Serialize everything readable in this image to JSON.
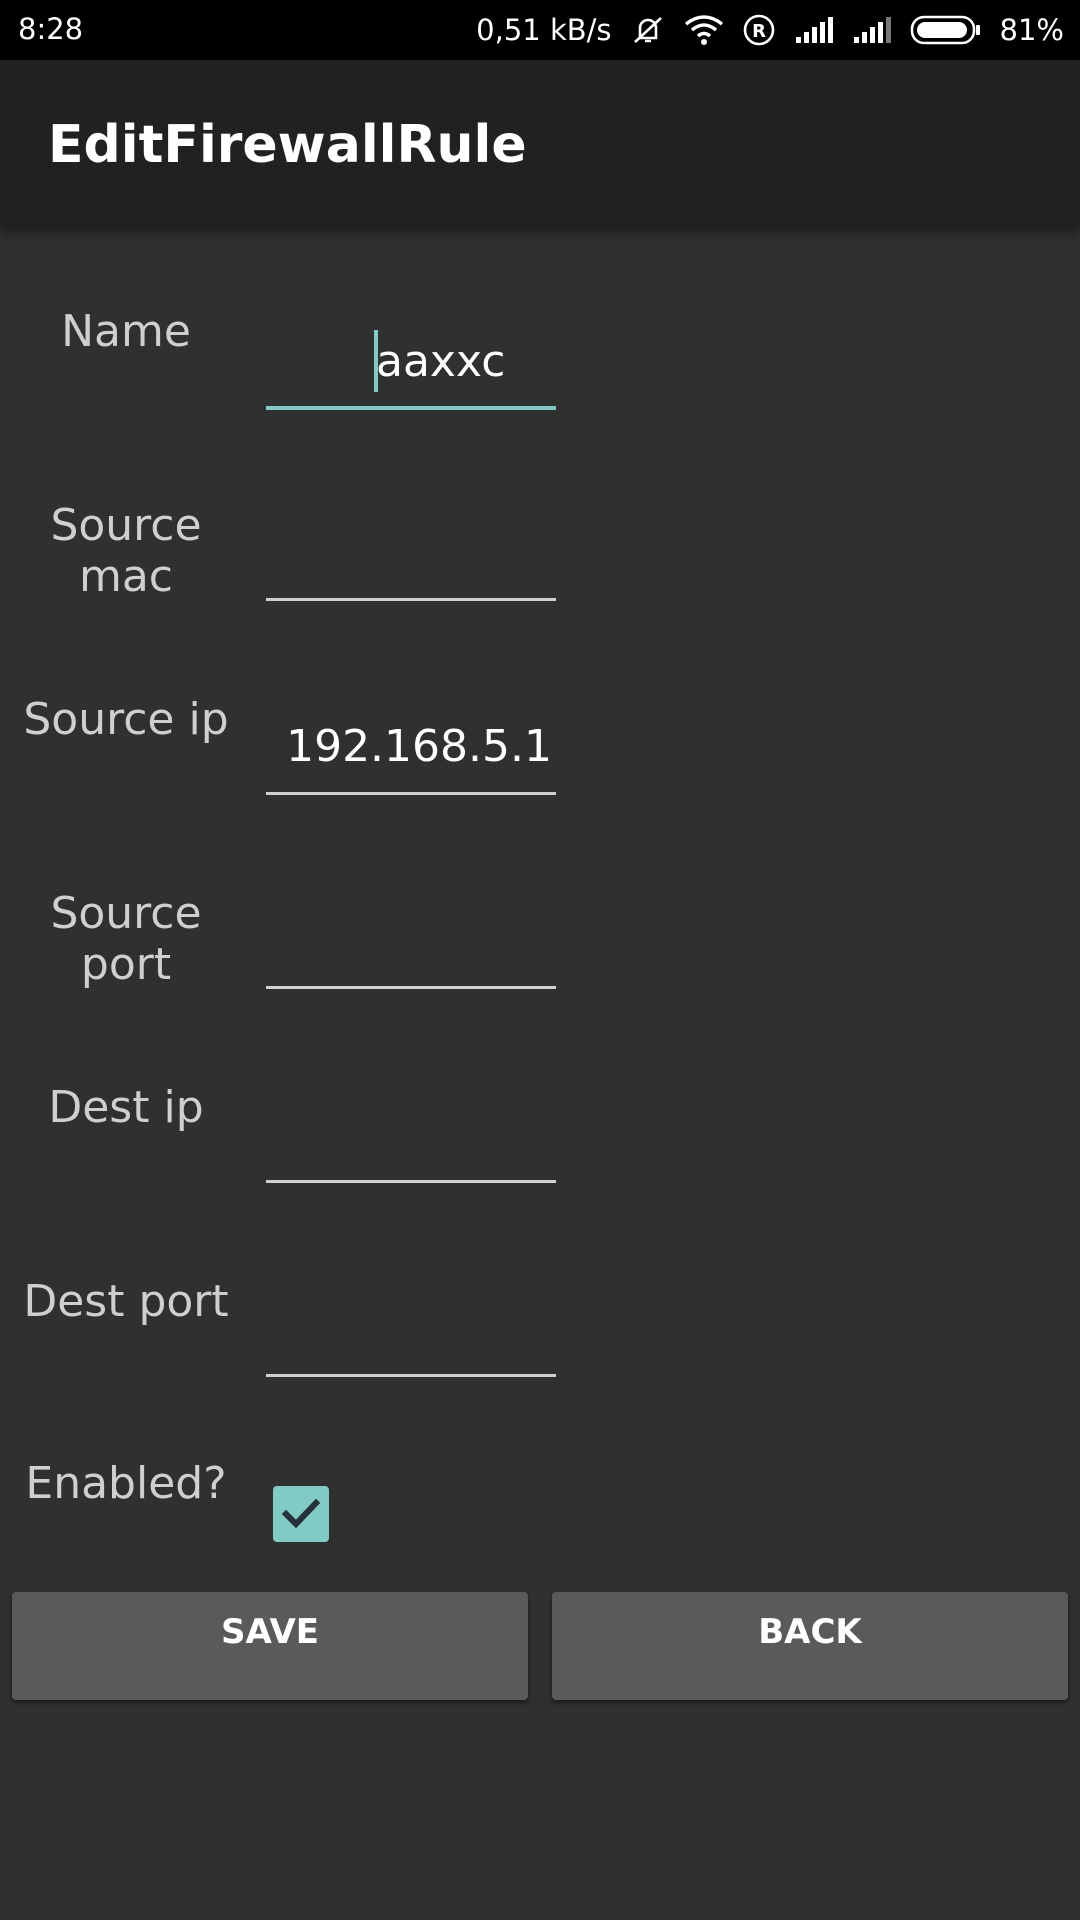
{
  "status_bar": {
    "time": "8:28",
    "network_speed": "0,51 kB/s",
    "battery_percent": "81%",
    "icons": [
      "vibrate-off-icon",
      "wifi-icon",
      "roaming-r-icon",
      "signal-icon",
      "signal-icon",
      "battery-icon"
    ]
  },
  "app_bar": {
    "title": "EditFirewallRule"
  },
  "form": {
    "name": {
      "label": "Name",
      "value": "aaxxc"
    },
    "source_mac": {
      "label": "Source mac",
      "value": ""
    },
    "source_ip": {
      "label": "Source ip",
      "value": "192.168.5.1"
    },
    "source_port": {
      "label": "Source port",
      "value": ""
    },
    "dest_ip": {
      "label": "Dest ip",
      "value": ""
    },
    "dest_port": {
      "label": "Dest port",
      "value": ""
    },
    "enabled": {
      "label": "Enabled?",
      "checked": true
    }
  },
  "buttons": {
    "save": "SAVE",
    "back": "BACK"
  },
  "colors": {
    "background": "#303030",
    "app_bar": "#212121",
    "accent": "#80cbc4",
    "button": "#5a5a5b",
    "status_bar": "#000000"
  }
}
